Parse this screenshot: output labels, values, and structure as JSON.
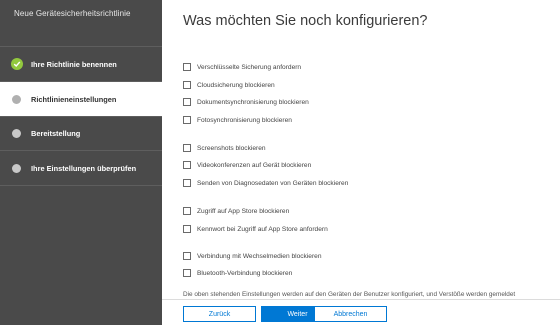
{
  "sidebar": {
    "title": "Neue Gerätesicherheitsrichtlinie",
    "steps": [
      {
        "label": "Ihre Richtlinie benennen",
        "state": "completed"
      },
      {
        "label": "Richtlinieneinstellungen",
        "state": "active"
      },
      {
        "label": "Bereitstellung",
        "state": "pending"
      },
      {
        "label": "Ihre Einstellungen überprüfen",
        "state": "pending"
      }
    ]
  },
  "main": {
    "heading": "Was möchten Sie noch konfigurieren?",
    "options": [
      {
        "label": "Verschlüsselte Sicherung anfordern",
        "checked": false
      },
      {
        "label": "Cloudsicherung blockieren",
        "checked": false
      },
      {
        "label": "Dokumentsynchronisierung blockieren",
        "checked": false
      },
      {
        "label": "Fotosynchronisierung blockieren",
        "checked": false
      },
      {
        "label": "Screenshots blockieren",
        "checked": false
      },
      {
        "label": "Videokonferenzen auf Gerät blockieren",
        "checked": false
      },
      {
        "label": "Senden von Diagnosedaten von Geräten blockieren",
        "checked": false
      },
      {
        "label": "Zugriff auf App Store blockieren",
        "checked": false
      },
      {
        "label": "Kennwort bei Zugriff auf App Store anfordern",
        "checked": false
      },
      {
        "label": "Verbindung mit Wechselmedien blockieren",
        "checked": false
      },
      {
        "label": "Bluetooth-Verbindung blockieren",
        "checked": false
      }
    ],
    "footer_text": "Die oben stehenden Einstellungen werden auf den Geräten der Benutzer konfiguriert, und Verstöße werden gemeldet"
  },
  "buttons": {
    "back": "Zurück",
    "next": "Weiter",
    "cancel": "Abbrechen"
  },
  "colors": {
    "sidebar_bg": "#4a4a4a",
    "accent": "#0078d4",
    "completed": "#92c83e"
  }
}
